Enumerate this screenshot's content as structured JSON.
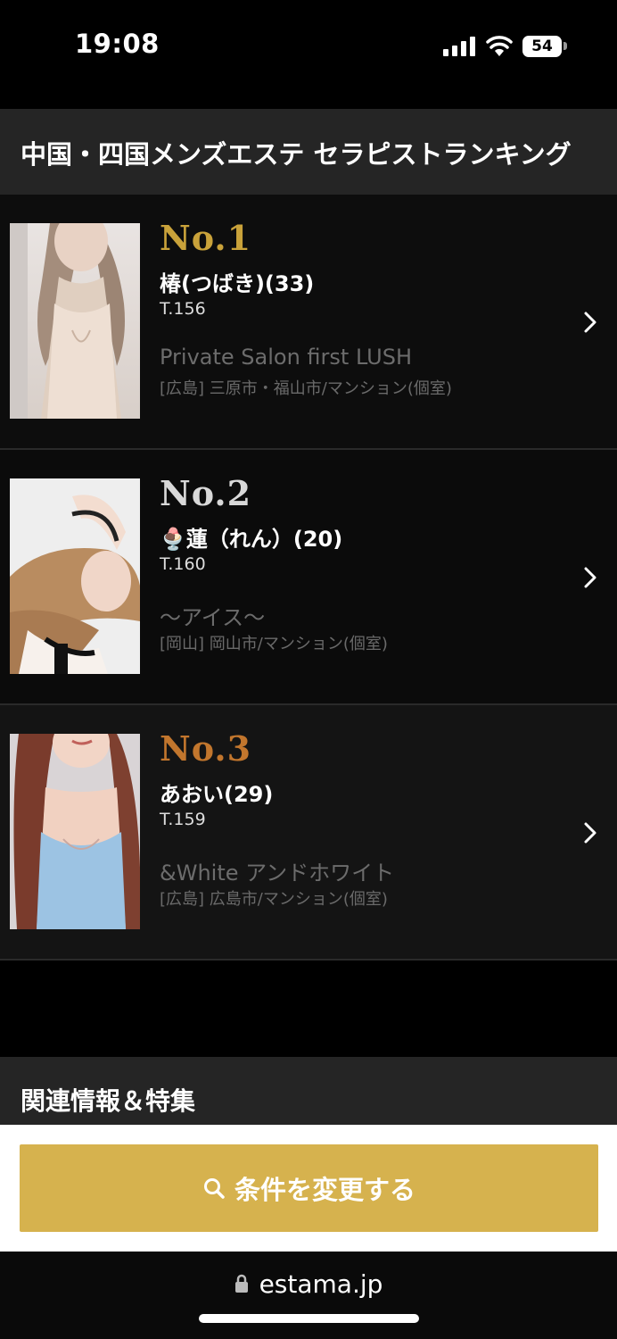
{
  "status_bar": {
    "time": "19:08",
    "battery": "54"
  },
  "header": {
    "title": "中国・四国メンズエステ セラピストランキング"
  },
  "ranking": [
    {
      "rank": "No.1",
      "name": "椿(つばき)(33)",
      "height": "T.156",
      "shop": "Private Salon first LUSH",
      "area": "[広島] 三原市・福山市/マンション(個室)"
    },
    {
      "rank": "No.2",
      "name": "🍨蓮（れん）(20)",
      "height": "T.160",
      "shop": "〜アイス〜",
      "area": "[岡山] 岡山市/マンション(個室)"
    },
    {
      "rank": "No.3",
      "name": "あおい(29)",
      "height": "T.159",
      "shop": "&White アンドホワイト",
      "area": "[広島] 広島市/マンション(個室)"
    }
  ],
  "related": {
    "title": "関連情報＆特集"
  },
  "actions": {
    "change_conditions": "条件を変更する"
  },
  "browser": {
    "url": "estama.jp"
  },
  "colors": {
    "accent": "#d6b24e",
    "gold": "#c9a23a",
    "silver": "#d8d8d8",
    "bronze": "#c2762d"
  }
}
